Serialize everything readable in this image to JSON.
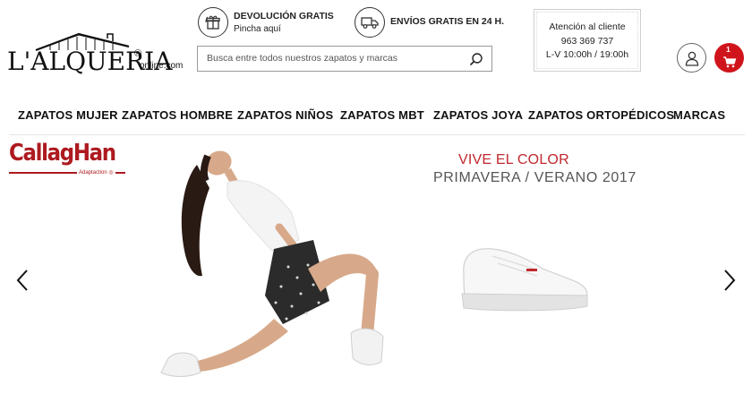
{
  "logo": {
    "wordmark": "L'ALQUERIA",
    "registered": "®",
    "suffix": "online.com"
  },
  "promos": [
    {
      "title": "DEVOLUCIÓN GRATIS",
      "subtitle": "Pincha aquí",
      "icon": "gift-box-icon"
    },
    {
      "title": "ENVÍOS GRATIS EN 24 H.",
      "subtitle": "",
      "icon": "delivery-truck-icon"
    }
  ],
  "search": {
    "placeholder": "Busca entre todos nuestros zapatos y marcas",
    "value": "",
    "icon": "search-icon"
  },
  "contact": {
    "title": "Atención al cliente",
    "phone": "963 369 737",
    "hours": "L-V 10:00h / 19:00h"
  },
  "account": {
    "icon": "user-icon"
  },
  "cart": {
    "count": "1",
    "icon": "cart-icon",
    "color": "#d0141c"
  },
  "nav": {
    "items": [
      {
        "label": "ZAPATOS MUJER"
      },
      {
        "label": "ZAPATOS HOMBRE"
      },
      {
        "label": "ZAPATOS NIÑOS"
      },
      {
        "label": "ZAPATOS MBT"
      },
      {
        "label": "ZAPATOS JOYA"
      },
      {
        "label": "ZAPATOS ORTOPÉDICOS"
      },
      {
        "label": "MARCAS"
      }
    ]
  },
  "hero": {
    "brand_name": "CallagHan",
    "brand_tagline": "Adaptaction ◎",
    "headline": "VIVE EL COLOR",
    "subheadline": "PRIMAVERA / VERANO 2017",
    "brand_color": "#ad1a1f",
    "headline_color": "#c0282d",
    "prev_icon": "chevron-left-icon",
    "next_icon": "chevron-right-icon"
  }
}
